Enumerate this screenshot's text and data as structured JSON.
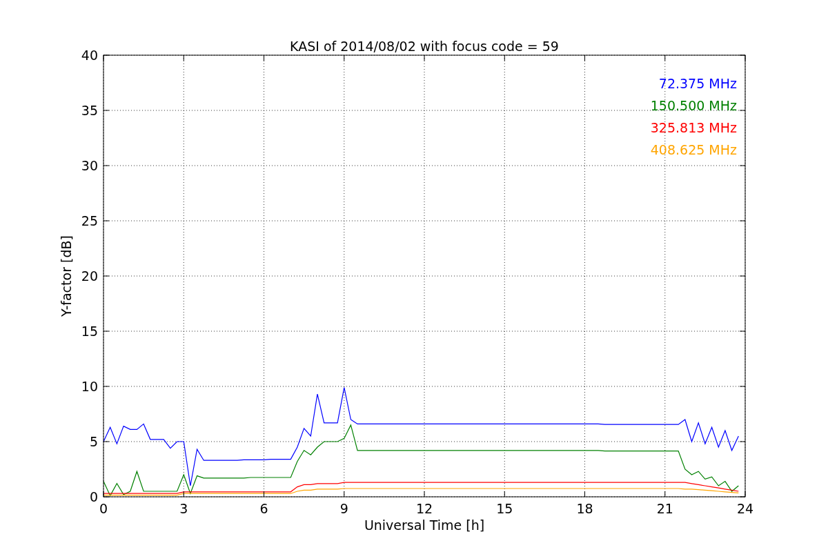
{
  "figure": {
    "chart_data": {
      "type": "line",
      "title": "KASI of 2014/08/02 with focus code = 59",
      "xlabel": "Universal Time [h]",
      "ylabel": "Y-factor [dB]",
      "x": [
        0,
        0.25,
        0.5,
        0.75,
        1,
        1.25,
        1.5,
        1.75,
        2,
        2.25,
        2.5,
        2.75,
        3,
        3.25,
        3.5,
        3.75,
        4,
        4.25,
        4.5,
        4.75,
        5,
        5.25,
        5.5,
        5.75,
        6,
        6.25,
        6.5,
        6.75,
        7,
        7.25,
        7.5,
        7.75,
        8,
        8.25,
        8.5,
        8.75,
        9,
        9.25,
        9.5,
        9.75,
        10,
        10.25,
        10.5,
        10.75,
        11,
        11.25,
        11.5,
        11.75,
        12,
        12.25,
        12.5,
        12.75,
        13,
        13.25,
        13.5,
        13.75,
        14,
        14.25,
        14.5,
        14.75,
        15,
        15.25,
        15.5,
        15.75,
        16,
        16.25,
        16.5,
        16.75,
        17,
        17.25,
        17.5,
        17.75,
        18,
        18.25,
        18.5,
        18.75,
        19,
        19.25,
        19.5,
        19.75,
        20,
        20.25,
        20.5,
        20.75,
        21,
        21.25,
        21.5,
        21.75,
        22,
        22.25,
        22.5,
        22.75,
        23,
        23.25,
        23.5,
        23.75
      ],
      "series": [
        {
          "name": "72.375 MHz",
          "color": "#0000ff",
          "values": [
            5.0,
            6.3,
            4.8,
            6.4,
            6.1,
            6.1,
            6.6,
            5.2,
            5.2,
            5.2,
            4.4,
            5.0,
            5.0,
            1.0,
            4.3,
            3.3,
            3.3,
            3.3,
            3.3,
            3.3,
            3.3,
            3.35,
            3.35,
            3.35,
            3.35,
            3.4,
            3.4,
            3.4,
            3.4,
            4.5,
            6.2,
            5.5,
            9.3,
            6.7,
            6.7,
            6.7,
            9.9,
            7.0,
            6.6,
            6.6,
            6.6,
            6.6,
            6.6,
            6.6,
            6.6,
            6.6,
            6.6,
            6.6,
            6.6,
            6.6,
            6.6,
            6.6,
            6.6,
            6.6,
            6.6,
            6.6,
            6.6,
            6.6,
            6.6,
            6.6,
            6.6,
            6.6,
            6.6,
            6.6,
            6.6,
            6.6,
            6.6,
            6.6,
            6.6,
            6.6,
            6.6,
            6.6,
            6.6,
            6.6,
            6.6,
            6.55,
            6.55,
            6.55,
            6.55,
            6.55,
            6.55,
            6.55,
            6.55,
            6.55,
            6.55,
            6.55,
            6.55,
            7.0,
            5.0,
            6.7,
            4.8,
            6.3,
            4.5,
            6.0,
            4.2,
            5.5
          ]
        },
        {
          "name": "150.500 MHz",
          "color": "#008000",
          "values": [
            1.4,
            0.1,
            1.2,
            0.2,
            0.5,
            2.3,
            0.5,
            0.5,
            0.5,
            0.5,
            0.5,
            0.5,
            2.0,
            0.3,
            1.9,
            1.7,
            1.7,
            1.7,
            1.7,
            1.7,
            1.7,
            1.7,
            1.75,
            1.75,
            1.75,
            1.75,
            1.75,
            1.75,
            1.75,
            3.2,
            4.2,
            3.8,
            4.5,
            5.0,
            5.0,
            5.0,
            5.3,
            6.5,
            4.2,
            4.2,
            4.2,
            4.2,
            4.2,
            4.2,
            4.2,
            4.2,
            4.2,
            4.2,
            4.2,
            4.2,
            4.2,
            4.2,
            4.2,
            4.2,
            4.2,
            4.2,
            4.2,
            4.2,
            4.2,
            4.2,
            4.2,
            4.2,
            4.2,
            4.2,
            4.2,
            4.2,
            4.2,
            4.2,
            4.2,
            4.2,
            4.2,
            4.2,
            4.2,
            4.2,
            4.2,
            4.15,
            4.15,
            4.15,
            4.15,
            4.15,
            4.15,
            4.15,
            4.15,
            4.15,
            4.15,
            4.15,
            4.15,
            2.5,
            2.0,
            2.3,
            1.6,
            1.8,
            1.0,
            1.4,
            0.5,
            1.0
          ]
        },
        {
          "name": "325.813 MHz",
          "color": "#ff0000",
          "values": [
            0.3,
            0.3,
            0.3,
            0.3,
            0.3,
            0.3,
            0.3,
            0.3,
            0.3,
            0.3,
            0.3,
            0.3,
            0.45,
            0.45,
            0.45,
            0.45,
            0.45,
            0.45,
            0.45,
            0.45,
            0.45,
            0.45,
            0.45,
            0.45,
            0.45,
            0.45,
            0.45,
            0.45,
            0.45,
            0.9,
            1.1,
            1.1,
            1.2,
            1.2,
            1.2,
            1.2,
            1.3,
            1.3,
            1.3,
            1.3,
            1.3,
            1.3,
            1.3,
            1.3,
            1.3,
            1.3,
            1.3,
            1.3,
            1.3,
            1.3,
            1.3,
            1.3,
            1.3,
            1.3,
            1.3,
            1.3,
            1.3,
            1.3,
            1.3,
            1.3,
            1.3,
            1.3,
            1.3,
            1.3,
            1.3,
            1.3,
            1.3,
            1.3,
            1.3,
            1.3,
            1.3,
            1.3,
            1.3,
            1.3,
            1.3,
            1.3,
            1.3,
            1.3,
            1.3,
            1.3,
            1.3,
            1.3,
            1.3,
            1.3,
            1.3,
            1.3,
            1.3,
            1.3,
            1.2,
            1.1,
            1.0,
            0.9,
            0.8,
            0.7,
            0.6,
            0.5
          ]
        },
        {
          "name": "408.625 MHz",
          "color": "#ffa500",
          "values": [
            0.15,
            0.15,
            0.15,
            0.15,
            0.15,
            0.15,
            0.15,
            0.15,
            0.15,
            0.15,
            0.15,
            0.15,
            0.3,
            0.3,
            0.3,
            0.3,
            0.3,
            0.3,
            0.3,
            0.3,
            0.3,
            0.3,
            0.3,
            0.3,
            0.3,
            0.3,
            0.3,
            0.3,
            0.3,
            0.5,
            0.6,
            0.6,
            0.7,
            0.7,
            0.7,
            0.7,
            0.75,
            0.75,
            0.75,
            0.75,
            0.75,
            0.75,
            0.75,
            0.75,
            0.75,
            0.75,
            0.75,
            0.75,
            0.75,
            0.75,
            0.75,
            0.75,
            0.75,
            0.75,
            0.75,
            0.75,
            0.75,
            0.75,
            0.75,
            0.75,
            0.75,
            0.75,
            0.75,
            0.75,
            0.75,
            0.75,
            0.75,
            0.75,
            0.75,
            0.75,
            0.75,
            0.75,
            0.75,
            0.75,
            0.75,
            0.75,
            0.75,
            0.75,
            0.75,
            0.75,
            0.75,
            0.75,
            0.75,
            0.75,
            0.75,
            0.75,
            0.75,
            0.7,
            0.7,
            0.65,
            0.6,
            0.55,
            0.5,
            0.45,
            0.4,
            0.35
          ]
        }
      ],
      "grid": true,
      "xlim": [
        0,
        24
      ],
      "ylim": [
        0,
        40
      ],
      "xticks": [
        0,
        3,
        6,
        9,
        12,
        15,
        18,
        21,
        24
      ],
      "yticks": [
        0,
        5,
        10,
        15,
        20,
        25,
        30,
        35,
        40
      ]
    }
  }
}
